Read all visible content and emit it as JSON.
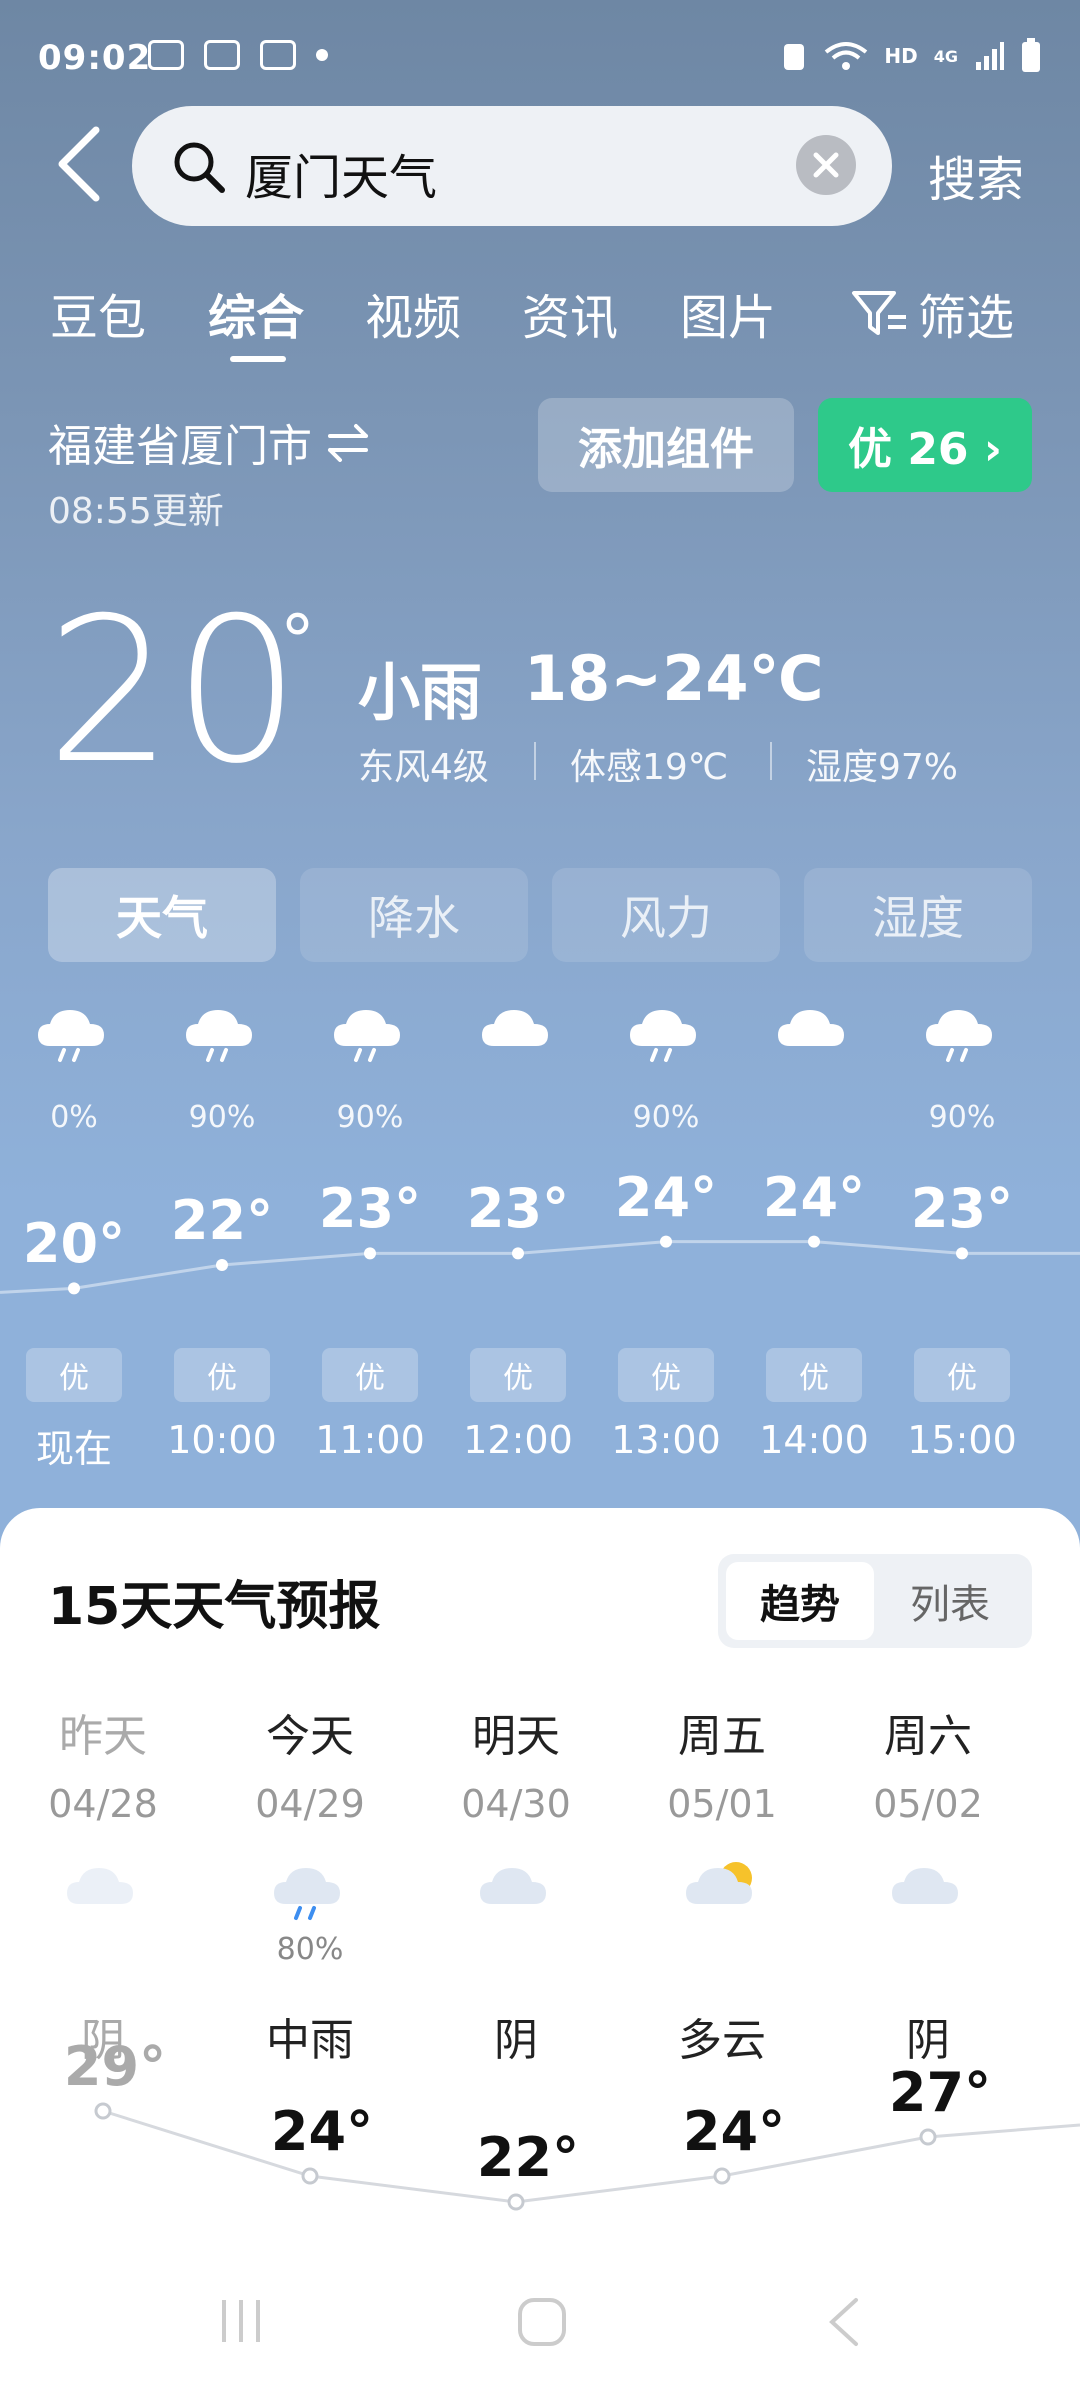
{
  "status_bar": {
    "time": "09:02",
    "network": "HD",
    "signal": "4G"
  },
  "search": {
    "query": "厦门天气",
    "button": "搜索"
  },
  "tabs": [
    "豆包",
    "综合",
    "视频",
    "资讯",
    "图片",
    "筛选"
  ],
  "active_tab": "综合",
  "location": {
    "city": "福建省厦门市",
    "updated": "08:55更新"
  },
  "buttons": {
    "add_widget": "添加组件",
    "aqi": "优 26 ›"
  },
  "current": {
    "temp": "20",
    "condition": "小雨",
    "range": "18~24℃",
    "wind": "东风4级",
    "feels": "体感19℃",
    "humidity": "湿度97%"
  },
  "segments": [
    "天气",
    "降水",
    "风力",
    "湿度"
  ],
  "hourly": [
    {
      "time": "现在",
      "precip": "0%",
      "temp": "20°",
      "aqi": "优",
      "icon": "rain-cloud-icon"
    },
    {
      "time": "10:00",
      "precip": "90%",
      "temp": "22°",
      "aqi": "优",
      "icon": "rain-cloud-icon"
    },
    {
      "time": "11:00",
      "precip": "90%",
      "temp": "23°",
      "aqi": "优",
      "icon": "rain-cloud-icon"
    },
    {
      "time": "12:00",
      "precip": "",
      "temp": "23°",
      "aqi": "优",
      "icon": "cloud-icon"
    },
    {
      "time": "13:00",
      "precip": "90%",
      "temp": "24°",
      "aqi": "优",
      "icon": "rain-cloud-icon"
    },
    {
      "time": "14:00",
      "precip": "",
      "temp": "24°",
      "aqi": "优",
      "icon": "cloud-icon"
    },
    {
      "time": "15:00",
      "precip": "90%",
      "temp": "23°",
      "aqi": "优",
      "icon": "rain-cloud-icon"
    }
  ],
  "forecast": {
    "title": "15天天气预报",
    "toggle": {
      "on": "趋势",
      "off": "列表"
    },
    "days": [
      {
        "name": "昨天",
        "date": "04/28",
        "cond": "阴",
        "high": "29°",
        "pct": "",
        "icon": "cloud-icon"
      },
      {
        "name": "今天",
        "date": "04/29",
        "cond": "中雨",
        "high": "24°",
        "pct": "80%",
        "icon": "rain-cloud-icon"
      },
      {
        "name": "明天",
        "date": "04/30",
        "cond": "阴",
        "high": "22°",
        "pct": "",
        "icon": "cloud-icon"
      },
      {
        "name": "周五",
        "date": "05/01",
        "cond": "多云",
        "high": "24°",
        "pct": "",
        "icon": "partly-cloudy-icon"
      },
      {
        "name": "周六",
        "date": "05/02",
        "cond": "阴",
        "high": "27°",
        "pct": "",
        "icon": "cloud-icon"
      }
    ]
  }
}
